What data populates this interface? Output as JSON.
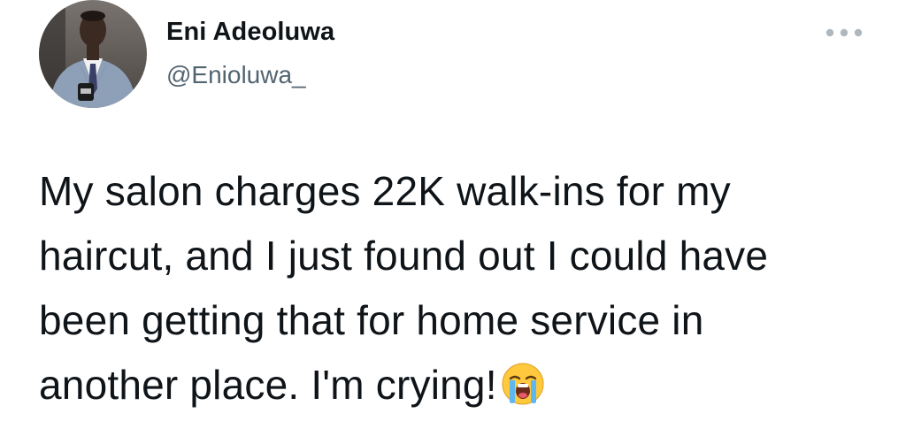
{
  "author": {
    "display_name": "Eni Adeoluwa",
    "handle": "@Enioluwa_"
  },
  "tweet": {
    "lines": [
      "My salon charges 22K walk-ins for my",
      "haircut, and I just found out I could have",
      "been getting that for home service in",
      "another place. I'm crying!"
    ],
    "trailing_emoji": "loudly-crying-face-emoji"
  },
  "icons": {
    "more": "more-options-icon"
  },
  "colors": {
    "text_primary": "#0f1419",
    "text_secondary": "#536471",
    "more_dots": "#b0b8bf",
    "background": "#ffffff"
  }
}
